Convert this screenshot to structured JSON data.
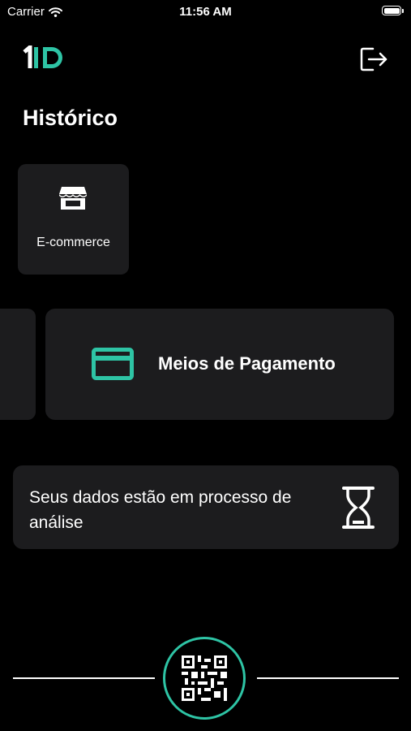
{
  "status_bar": {
    "carrier": "Carrier",
    "time": "11:56 AM"
  },
  "header": {
    "logo_text": "1ID",
    "logo_icon": "1id-logo",
    "logout_icon": "logout-icon"
  },
  "page": {
    "title": "Histórico"
  },
  "categories": [
    {
      "label": "E-commerce",
      "icon": "storefront-icon"
    }
  ],
  "carousel": {
    "active_item": {
      "label": "Meios de Pagamento",
      "icon": "credit-card-icon"
    }
  },
  "status_card": {
    "message": "Seus dados estão em processo de análise",
    "icon": "hourglass-icon"
  },
  "bottom_bar": {
    "qr_icon": "qr-code-icon"
  },
  "colors": {
    "accent": "#2ec4a5",
    "background": "#000000",
    "card": "#1c1c1e",
    "text": "#ffffff"
  }
}
